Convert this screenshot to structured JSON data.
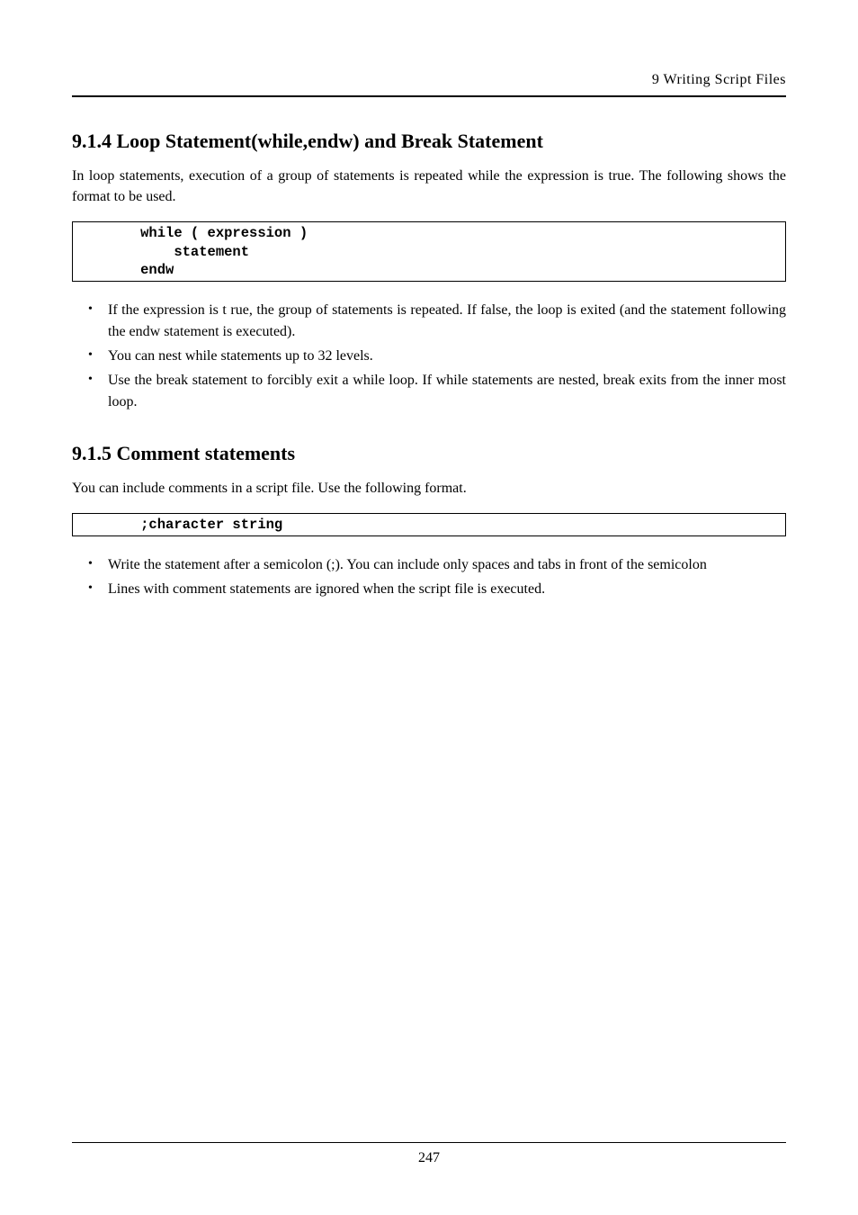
{
  "header": {
    "running_head": "9  Writing  Script  Files"
  },
  "sections": [
    {
      "title": "9.1.4 Loop Statement(while,endw) and Break Statement",
      "intro": "In loop statements, execution of a group of statements is repeated while the expression is true. The following shows the format to be used.",
      "code_lines": [
        "       while ( expression )",
        "           statement",
        "       endw"
      ],
      "bullets": [
        "If the expression is t rue, the group of statements is repeated. If false, the loop is exited (and the statement following the endw statement is executed).",
        "You can nest while statements up to 32 levels.",
        "Use the break statement to forcibly exit a while loop. If while statements are nested, break exits from the inner most loop."
      ]
    },
    {
      "title": "9.1.5 Comment statements",
      "intro": "You can include comments in a script file. Use the following format.",
      "code_lines": [
        "       ;character string"
      ],
      "bullets": [
        "Write the statement after a semicolon (;). You can include only spaces and tabs in front of the semicolon",
        "Lines with comment statements are ignored when the script file is executed."
      ]
    }
  ],
  "footer": {
    "page_number": "247"
  }
}
